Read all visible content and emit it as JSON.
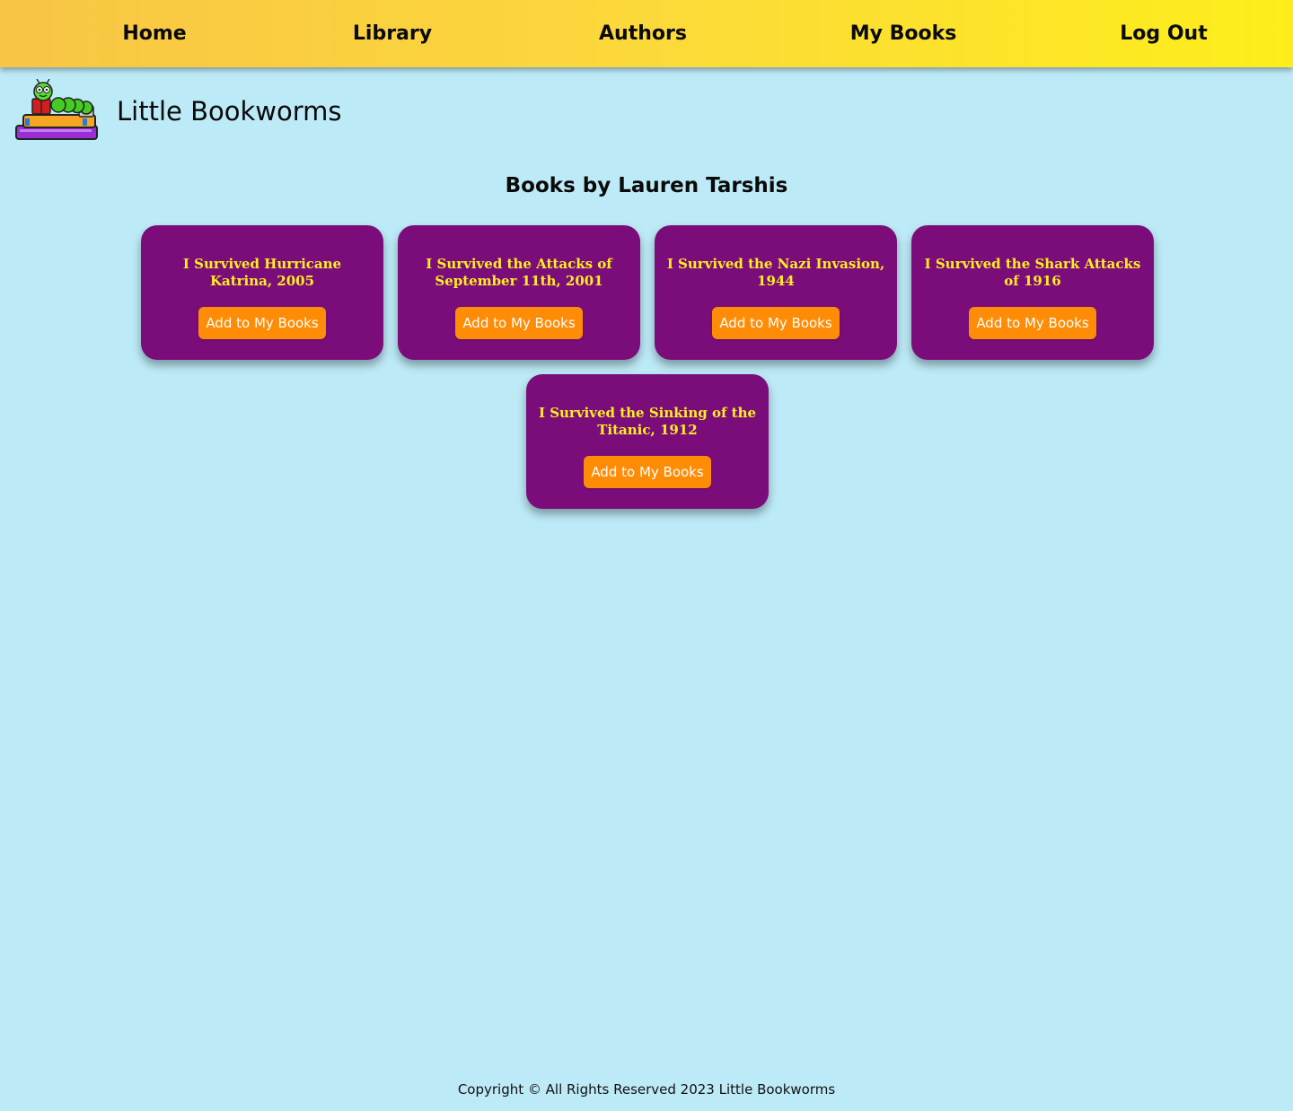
{
  "nav": {
    "items": [
      {
        "label": "Home"
      },
      {
        "label": "Library"
      },
      {
        "label": "Authors"
      },
      {
        "label": "My Books"
      },
      {
        "label": "Log Out"
      }
    ]
  },
  "brand": {
    "title": "Little Bookworms",
    "logo_icon": "bookworm-on-books-icon"
  },
  "page": {
    "heading": "Books by Lauren Tarshis"
  },
  "books": [
    {
      "title": "I Survived Hurricane Katrina, 2005",
      "button_label": "Add to My Books"
    },
    {
      "title": "I Survived the Attacks of September 11th, 2001",
      "button_label": "Add to My Books"
    },
    {
      "title": "I Survived the Nazi Invasion, 1944",
      "button_label": "Add to My Books"
    },
    {
      "title": "I Survived the Shark Attacks of 1916",
      "button_label": "Add to My Books"
    },
    {
      "title": "I Survived the Sinking of the Titanic, 1912",
      "button_label": "Add to My Books"
    }
  ],
  "footer": {
    "text": "Copyright © All Rights Reserved 2023 Little Bookworms"
  },
  "colors": {
    "background": "#bdeaf7",
    "nav_gradient_start": "#f8c545",
    "nav_gradient_end": "#fdee1b",
    "card": "#7b0d7b",
    "card_title": "#ffee22",
    "button": "#ff8c06"
  }
}
